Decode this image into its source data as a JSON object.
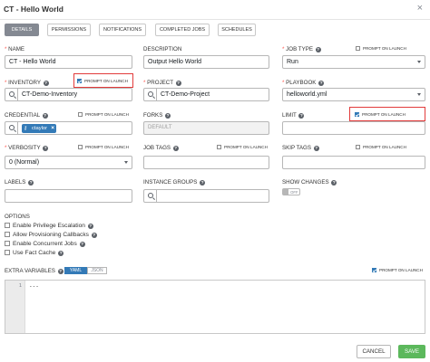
{
  "header": {
    "title": "CT - Hello World",
    "close_symbol": "×"
  },
  "tabs": [
    {
      "label": "Details",
      "active": true
    },
    {
      "label": "Permissions",
      "active": false
    },
    {
      "label": "Notifications",
      "active": false
    },
    {
      "label": "Completed Jobs",
      "active": false
    },
    {
      "label": "Schedules",
      "active": false
    }
  ],
  "prompt_label": "Prompt on launch",
  "form": {
    "name": {
      "label": "Name",
      "value": "CT - Hello World"
    },
    "description": {
      "label": "Description",
      "value": "Output Hello World"
    },
    "job_type": {
      "label": "Job Type",
      "value": "Run",
      "prompt_on_launch": false
    },
    "inventory": {
      "label": "Inventory",
      "value": "CT-Demo-Inventory",
      "prompt_on_launch": true
    },
    "project": {
      "label": "Project",
      "value": "CT-Demo-Project"
    },
    "playbook": {
      "label": "Playbook",
      "value": "helloworld.yml"
    },
    "credential": {
      "label": "Credential",
      "chip": "ctaylor",
      "chip_remove": "×",
      "prompt_on_launch": false
    },
    "forks": {
      "label": "Forks",
      "placeholder": "DEFAULT"
    },
    "limit": {
      "label": "Limit",
      "value": "",
      "prompt_on_launch": true
    },
    "verbosity": {
      "label": "Verbosity",
      "value": "0 (Normal)",
      "prompt_on_launch": false
    },
    "job_tags": {
      "label": "Job Tags",
      "value": "",
      "prompt_on_launch": false
    },
    "skip_tags": {
      "label": "Skip Tags",
      "value": "",
      "prompt_on_launch": false
    },
    "labels": {
      "label": "Labels",
      "value": ""
    },
    "instance_groups": {
      "label": "Instance Groups",
      "value": ""
    },
    "show_changes": {
      "label": "Show Changes",
      "state": "OFF"
    }
  },
  "options": {
    "label": "Options",
    "items": [
      {
        "label": "Enable Privilege Escalation",
        "checked": false
      },
      {
        "label": "Allow Provisioning Callbacks",
        "checked": false
      },
      {
        "label": "Enable Concurrent Jobs",
        "checked": false
      },
      {
        "label": "Use Fact Cache",
        "checked": false
      }
    ]
  },
  "extra_variables": {
    "label": "Extra Variables",
    "format_yaml": "YAML",
    "format_json": "JSON",
    "active_format": "YAML",
    "prompt_on_launch": true,
    "line_numbers": [
      "1"
    ],
    "code": "---"
  },
  "actions": {
    "cancel": "Cancel",
    "save": "Save"
  },
  "colors": {
    "primary": "#337ab7",
    "save": "#5cb85c",
    "required": "#ff5850",
    "highlight": "#e23b3b"
  },
  "icons": {
    "lookup": "search-icon",
    "credential_chip": "key-icon",
    "close": "close-icon"
  }
}
